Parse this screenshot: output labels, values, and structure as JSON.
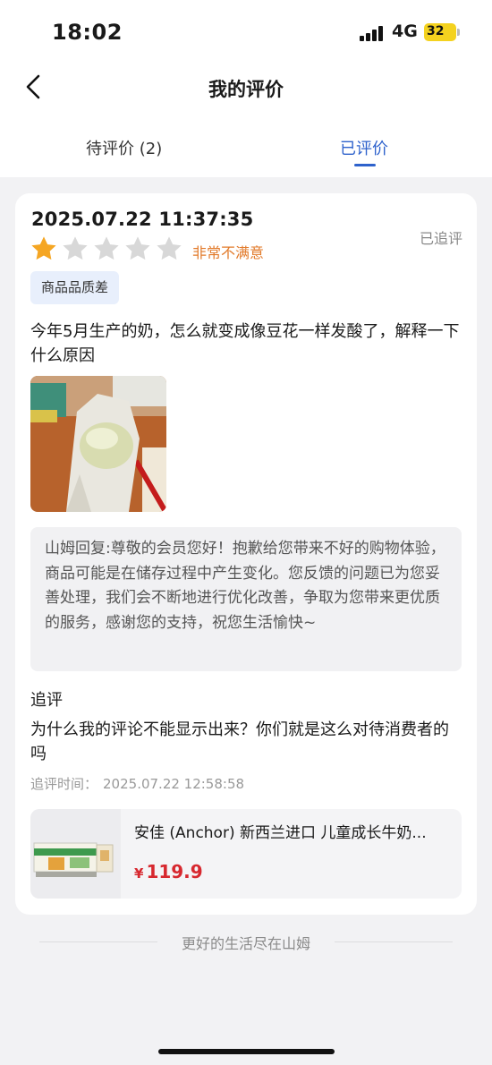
{
  "status_bar": {
    "time": "18:02",
    "network": "4G",
    "battery": "32"
  },
  "nav": {
    "back_icon": "chevron-left-icon",
    "title": "我的评价"
  },
  "tabs": [
    {
      "label": "待评价 (2)",
      "active": false
    },
    {
      "label": "已评价",
      "active": true
    }
  ],
  "review": {
    "time": "2025.07.22 11:37:35",
    "followed_status": "已追评",
    "rating": 1,
    "max_rating": 5,
    "rating_text": "非常不满意",
    "tag": "商品品质差",
    "text": "今年5月生产的奶，怎么就变成像豆花一样发酸了，解释一下什么原因",
    "reply": "山姆回复:尊敬的会员您好！抱歉给您带来不好的购物体验，商品可能是在储存过程中产生变化。您反馈的问题已为您妥善处理，我们会不断地进行优化改善，争取为您带来更优质的服务，感谢您的支持，祝您生活愉快~",
    "followup_title": "追评",
    "followup_text": "为什么我的评论不能显示出来？你们就是这么对待消费者的吗",
    "followup_time_label": "追评时间：",
    "followup_time": "2025.07.22 12:58:58"
  },
  "product": {
    "name": "安佳 (Anchor) 新西兰进口 儿童成长牛奶...",
    "price_symbol": "¥",
    "price": "119.9"
  },
  "footer": {
    "text": "更好的生活尽在山姆"
  },
  "colors": {
    "accent": "#2e62cc",
    "star_active": "#f5a623",
    "star_inactive": "#d8d8d8",
    "rating_text": "#e27a2a",
    "price": "#d7282f"
  }
}
